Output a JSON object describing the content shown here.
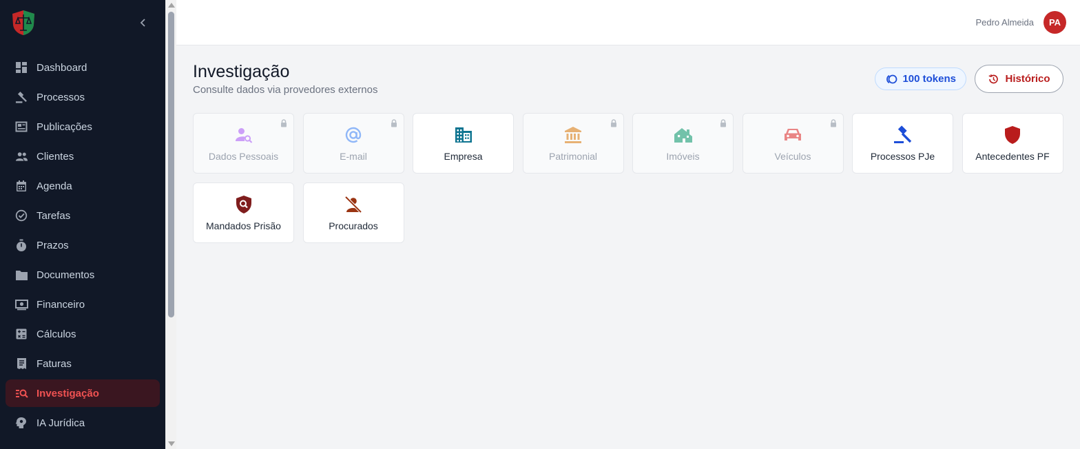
{
  "sidebar": {
    "items": [
      {
        "label": "Dashboard",
        "icon": "dashboard-icon",
        "active": false
      },
      {
        "label": "Processos",
        "icon": "gavel-icon",
        "active": false
      },
      {
        "label": "Publicações",
        "icon": "newspaper-icon",
        "active": false
      },
      {
        "label": "Clientes",
        "icon": "people-icon",
        "active": false
      },
      {
        "label": "Agenda",
        "icon": "calendar-icon",
        "active": false
      },
      {
        "label": "Tarefas",
        "icon": "check-circle-icon",
        "active": false
      },
      {
        "label": "Prazos",
        "icon": "timer-icon",
        "active": false
      },
      {
        "label": "Documentos",
        "icon": "folder-icon",
        "active": false
      },
      {
        "label": "Financeiro",
        "icon": "money-icon",
        "active": false
      },
      {
        "label": "Cálculos",
        "icon": "calculator-icon",
        "active": false
      },
      {
        "label": "Faturas",
        "icon": "invoice-icon",
        "active": false
      },
      {
        "label": "Investigação",
        "icon": "manage-search-icon",
        "active": true
      },
      {
        "label": "IA Jurídica",
        "icon": "psychology-icon",
        "active": false
      }
    ],
    "colors": {
      "background": "#111827",
      "active_text": "#f05252",
      "active_bg": "#3a1620"
    }
  },
  "header": {
    "user_name": "Pedro Almeida",
    "avatar_initials": "PA"
  },
  "main": {
    "title": "Investigação",
    "subtitle": "Consulte dados via provedores externos",
    "tokens_label": "100 tokens",
    "history_label": "Histórico",
    "cards": [
      {
        "label": "Dados Pessoais",
        "icon": "person-search-icon",
        "color": "#a855f7",
        "locked": true
      },
      {
        "label": "E-mail",
        "icon": "at-sign-icon",
        "color": "#3b82f6",
        "locked": true
      },
      {
        "label": "Empresa",
        "icon": "building-icon",
        "color": "#0e7490",
        "locked": false
      },
      {
        "label": "Patrimonial",
        "icon": "bank-icon",
        "color": "#d97706",
        "locked": true
      },
      {
        "label": "Imóveis",
        "icon": "house-icon",
        "color": "#059669",
        "locked": true
      },
      {
        "label": "Veículos",
        "icon": "car-icon",
        "color": "#dc2626",
        "locked": true
      },
      {
        "label": "Processos PJe",
        "icon": "gavel-icon",
        "color": "#1d4ed8",
        "locked": false
      },
      {
        "label": "Antecedentes PF",
        "icon": "shield-icon",
        "color": "#b91c1c",
        "locked": false
      },
      {
        "label": "Mandados Prisão",
        "icon": "shield-search-icon",
        "color": "#7f1d1d",
        "locked": false
      },
      {
        "label": "Procurados",
        "icon": "person-off-icon",
        "color": "#9a3412",
        "locked": false
      }
    ]
  }
}
